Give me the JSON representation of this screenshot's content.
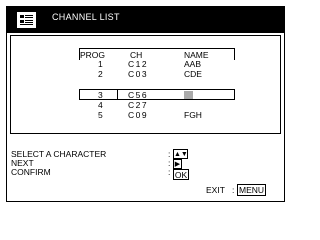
{
  "header": {
    "title": "CHANNEL LIST",
    "logo_icon": "channel-list-icon"
  },
  "table": {
    "columns": [
      "PROG",
      "CH",
      "NAME"
    ],
    "rows": [
      {
        "prog": "1",
        "ch": "C12",
        "name": "AAB"
      },
      {
        "prog": "2",
        "ch": "C03",
        "name": "CDE"
      },
      {
        "prog": "3",
        "ch": "C56",
        "name": ""
      },
      {
        "prog": "4",
        "ch": "C27",
        "name": ""
      },
      {
        "prog": "5",
        "ch": "C09",
        "name": "FGH"
      }
    ],
    "selected_row": 2
  },
  "controls": {
    "select_label": "SELECT A CHARACTER",
    "next_label": "NEXT",
    "confirm_label": "CONFIRM",
    "select_key": "▲▼",
    "next_key": "▶",
    "confirm_key": "OK",
    "exit_label": "EXIT",
    "menu_key": "MENU",
    "colon": ":"
  }
}
